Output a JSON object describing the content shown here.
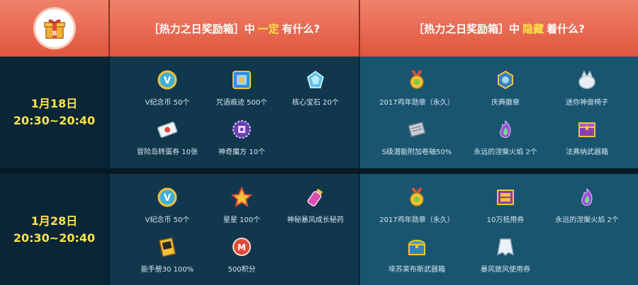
{
  "header": {
    "gift_icon": "gift-box-icon",
    "col_definite_prefix": "［热力之日奖励箱］中",
    "col_definite_highlight": "一定",
    "col_definite_suffix": "有什么?",
    "col_hidden_prefix": "［热力之日奖励箱］中",
    "col_hidden_highlight": "隐藏",
    "col_hidden_suffix": "着什么?",
    "highlight_color": "#ffe34a",
    "header_color": "#e86a52"
  },
  "rows": [
    {
      "date": "1月18日",
      "time": "20:30~20:40",
      "definite": [
        {
          "icon": "v-coin-icon",
          "label": "V纪念币 50个"
        },
        {
          "icon": "spell-trace-icon",
          "label": "咒语痕迹 500个"
        },
        {
          "icon": "core-gemstone-icon",
          "label": "核心宝石 20个"
        },
        {
          "icon": "gachapon-ticket-icon",
          "label": "冒险岛转蛋券 10张"
        },
        {
          "icon": "magic-cube-icon",
          "label": "神奇魔方 10个"
        }
      ],
      "hidden": [
        {
          "icon": "rooster-medal-icon",
          "label": "2017鸡年勋章（永久）"
        },
        {
          "icon": "celebration-badge-icon",
          "label": "庆典徽章"
        },
        {
          "icon": "beast-chair-icon",
          "label": "迷你神兽椅子"
        },
        {
          "icon": "scroll-icon",
          "label": "S级潜能附加卷轴50%"
        },
        {
          "icon": "flame-icon",
          "label": "永远的涅槃火焰 2个"
        },
        {
          "icon": "weapon-box-icon",
          "label": "法弗纳武器箱"
        }
      ]
    },
    {
      "date": "1月28日",
      "time": "20:30~20:40",
      "definite": [
        {
          "icon": "v-coin-icon",
          "label": "V纪念币 50个"
        },
        {
          "icon": "star-icon",
          "label": "星星 100个"
        },
        {
          "icon": "potion-icon",
          "label": "神秘暴风成长秘药"
        },
        {
          "icon": "skill-book-icon",
          "label": "能手册30 100%"
        },
        {
          "icon": "points-token-icon",
          "label": "500积分"
        }
      ],
      "hidden": [
        {
          "icon": "rooster-medal-icon",
          "label": "2017鸡年勋章（永久）"
        },
        {
          "icon": "voucher-icon",
          "label": "10万抵用券"
        },
        {
          "icon": "flame-icon",
          "label": "永远的涅槃火焰 2个"
        },
        {
          "icon": "treasure-chest-icon",
          "label": "埃苏莱布斯武器箱"
        },
        {
          "icon": "cloak-icon",
          "label": "暴风披风使用券"
        }
      ]
    }
  ]
}
